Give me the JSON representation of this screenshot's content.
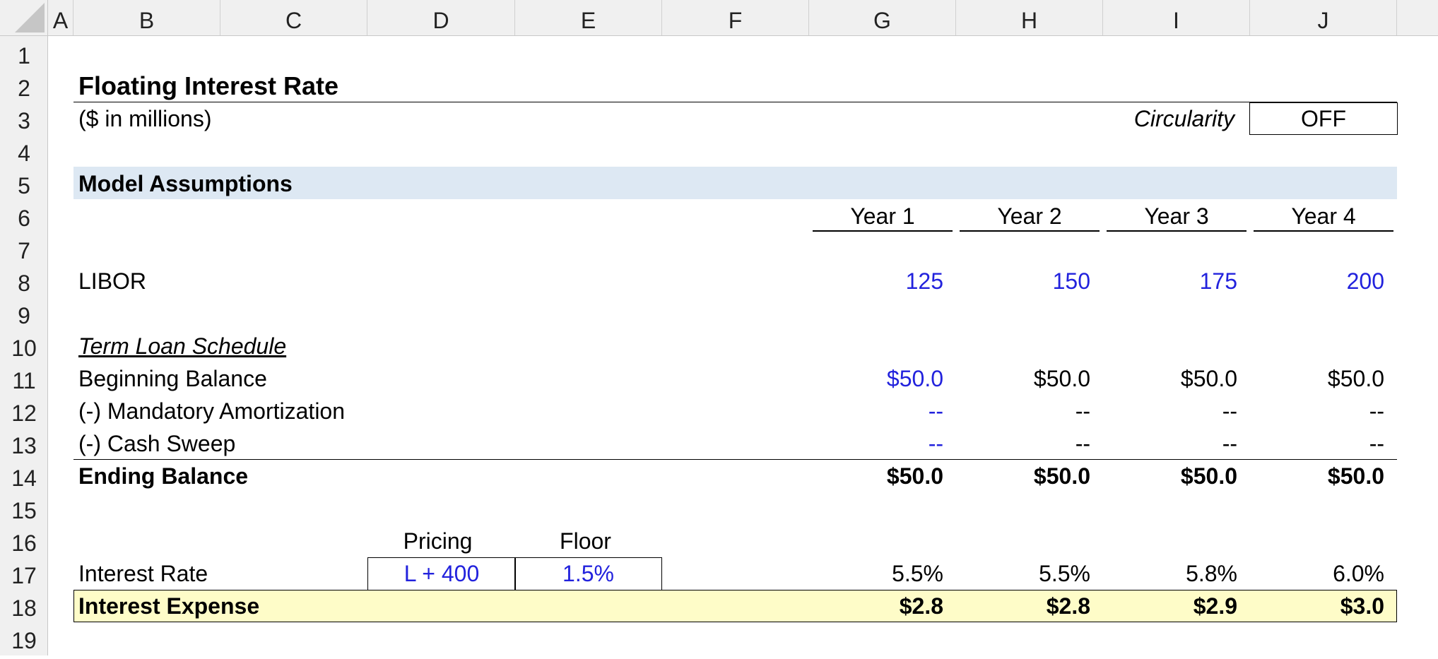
{
  "columns": [
    "A",
    "B",
    "C",
    "D",
    "E",
    "F",
    "G",
    "H",
    "I",
    "J"
  ],
  "rows": [
    "1",
    "2",
    "3",
    "4",
    "5",
    "6",
    "7",
    "8",
    "9",
    "10",
    "11",
    "12",
    "13",
    "14",
    "15",
    "16",
    "17",
    "18",
    "19"
  ],
  "title": "Floating Interest Rate",
  "subtitle": "($ in millions)",
  "circularity": {
    "label": "Circularity",
    "value": "OFF"
  },
  "section_title": "Model Assumptions",
  "years": [
    "Year 1",
    "Year 2",
    "Year 3",
    "Year 4"
  ],
  "libor": {
    "label": "LIBOR",
    "values": [
      "125",
      "150",
      "175",
      "200"
    ]
  },
  "term_loan_header": "Term Loan Schedule",
  "beginning_balance": {
    "label": "Beginning Balance",
    "values": [
      "$50.0",
      "$50.0",
      "$50.0",
      "$50.0"
    ]
  },
  "mandatory_amortization": {
    "label": "(-) Mandatory Amortization",
    "values": [
      "--",
      "--",
      "--",
      "--"
    ]
  },
  "cash_sweep": {
    "label": "(-) Cash Sweep",
    "values": [
      "--",
      "--",
      "--",
      "--"
    ]
  },
  "ending_balance": {
    "label": "Ending Balance",
    "values": [
      "$50.0",
      "$50.0",
      "$50.0",
      "$50.0"
    ]
  },
  "pricing": {
    "label": "Pricing",
    "value": "L + 400"
  },
  "floor": {
    "label": "Floor",
    "value": "1.5%"
  },
  "interest_rate": {
    "label": "Interest Rate",
    "values": [
      "5.5%",
      "5.5%",
      "5.8%",
      "6.0%"
    ]
  },
  "interest_expense": {
    "label": "Interest Expense",
    "values": [
      "$2.8",
      "$2.8",
      "$2.9",
      "$3.0"
    ]
  },
  "colors": {
    "input_blue": "#2222dd",
    "section_band": "#dde8f3",
    "highlight_yellow": "#fefcc8",
    "header_gray": "#f0f0f0"
  }
}
